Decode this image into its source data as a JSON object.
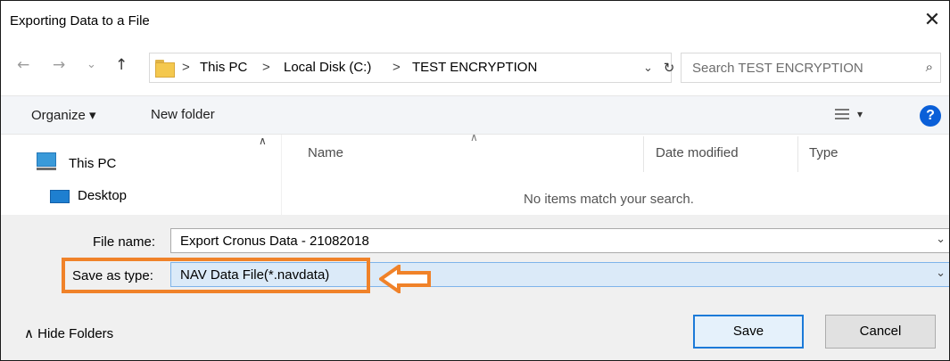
{
  "dialog": {
    "title": "Exporting Data to a File",
    "close_glyph": "✕"
  },
  "nav": {
    "back_glyph": "←",
    "forward_glyph": "→",
    "recent_glyph": "⌄",
    "up_glyph": "↑",
    "breadcrumb": [
      "This PC",
      "Local Disk (C:)",
      "TEST ENCRYPTION"
    ],
    "separator": ">",
    "dropdown_glyph": "⌄",
    "refresh_glyph": "↻"
  },
  "search": {
    "placeholder": "Search TEST ENCRYPTION",
    "icon_glyph": "⌕"
  },
  "toolbar": {
    "organize_label": "Organize ▾",
    "new_folder_label": "New folder",
    "view_dd_glyph": "▾",
    "help_glyph": "?"
  },
  "navpane": {
    "items": [
      "This PC",
      "Desktop"
    ],
    "scroll_glyph": "∧"
  },
  "filelist": {
    "columns": [
      "Name",
      "Date modified",
      "Type"
    ],
    "sort_glyph": "∧",
    "empty_message": "No items match your search."
  },
  "form": {
    "file_name_label": "File name:",
    "file_name_value": "Export Cronus Data - 21082018",
    "save_type_label": "Save as type:",
    "save_type_value": "NAV Data File(*.navdata)",
    "dropdown_glyph": "⌄"
  },
  "footer": {
    "hide_folders_label": "∧  Hide Folders",
    "save_label": "Save",
    "cancel_label": "Cancel"
  },
  "colors": {
    "highlight": "#f08229",
    "accent": "#1c7ad8"
  }
}
